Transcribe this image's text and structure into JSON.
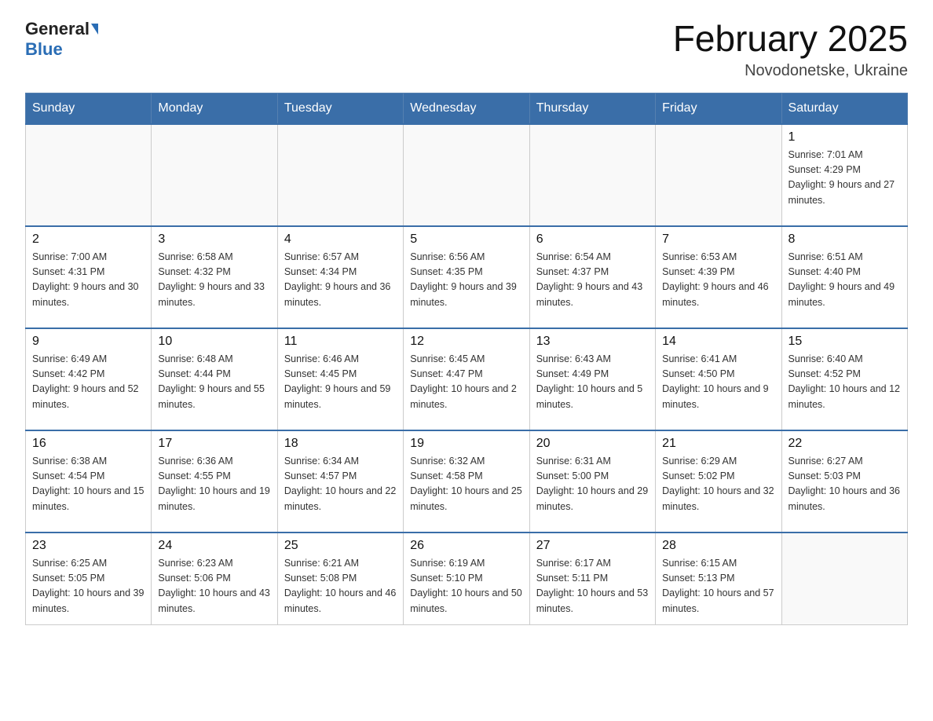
{
  "header": {
    "logo_general": "General",
    "logo_blue": "Blue",
    "title": "February 2025",
    "location": "Novodonetske, Ukraine"
  },
  "weekdays": [
    "Sunday",
    "Monday",
    "Tuesday",
    "Wednesday",
    "Thursday",
    "Friday",
    "Saturday"
  ],
  "weeks": [
    [
      {
        "day": "",
        "info": ""
      },
      {
        "day": "",
        "info": ""
      },
      {
        "day": "",
        "info": ""
      },
      {
        "day": "",
        "info": ""
      },
      {
        "day": "",
        "info": ""
      },
      {
        "day": "",
        "info": ""
      },
      {
        "day": "1",
        "info": "Sunrise: 7:01 AM\nSunset: 4:29 PM\nDaylight: 9 hours and 27 minutes."
      }
    ],
    [
      {
        "day": "2",
        "info": "Sunrise: 7:00 AM\nSunset: 4:31 PM\nDaylight: 9 hours and 30 minutes."
      },
      {
        "day": "3",
        "info": "Sunrise: 6:58 AM\nSunset: 4:32 PM\nDaylight: 9 hours and 33 minutes."
      },
      {
        "day": "4",
        "info": "Sunrise: 6:57 AM\nSunset: 4:34 PM\nDaylight: 9 hours and 36 minutes."
      },
      {
        "day": "5",
        "info": "Sunrise: 6:56 AM\nSunset: 4:35 PM\nDaylight: 9 hours and 39 minutes."
      },
      {
        "day": "6",
        "info": "Sunrise: 6:54 AM\nSunset: 4:37 PM\nDaylight: 9 hours and 43 minutes."
      },
      {
        "day": "7",
        "info": "Sunrise: 6:53 AM\nSunset: 4:39 PM\nDaylight: 9 hours and 46 minutes."
      },
      {
        "day": "8",
        "info": "Sunrise: 6:51 AM\nSunset: 4:40 PM\nDaylight: 9 hours and 49 minutes."
      }
    ],
    [
      {
        "day": "9",
        "info": "Sunrise: 6:49 AM\nSunset: 4:42 PM\nDaylight: 9 hours and 52 minutes."
      },
      {
        "day": "10",
        "info": "Sunrise: 6:48 AM\nSunset: 4:44 PM\nDaylight: 9 hours and 55 minutes."
      },
      {
        "day": "11",
        "info": "Sunrise: 6:46 AM\nSunset: 4:45 PM\nDaylight: 9 hours and 59 minutes."
      },
      {
        "day": "12",
        "info": "Sunrise: 6:45 AM\nSunset: 4:47 PM\nDaylight: 10 hours and 2 minutes."
      },
      {
        "day": "13",
        "info": "Sunrise: 6:43 AM\nSunset: 4:49 PM\nDaylight: 10 hours and 5 minutes."
      },
      {
        "day": "14",
        "info": "Sunrise: 6:41 AM\nSunset: 4:50 PM\nDaylight: 10 hours and 9 minutes."
      },
      {
        "day": "15",
        "info": "Sunrise: 6:40 AM\nSunset: 4:52 PM\nDaylight: 10 hours and 12 minutes."
      }
    ],
    [
      {
        "day": "16",
        "info": "Sunrise: 6:38 AM\nSunset: 4:54 PM\nDaylight: 10 hours and 15 minutes."
      },
      {
        "day": "17",
        "info": "Sunrise: 6:36 AM\nSunset: 4:55 PM\nDaylight: 10 hours and 19 minutes."
      },
      {
        "day": "18",
        "info": "Sunrise: 6:34 AM\nSunset: 4:57 PM\nDaylight: 10 hours and 22 minutes."
      },
      {
        "day": "19",
        "info": "Sunrise: 6:32 AM\nSunset: 4:58 PM\nDaylight: 10 hours and 25 minutes."
      },
      {
        "day": "20",
        "info": "Sunrise: 6:31 AM\nSunset: 5:00 PM\nDaylight: 10 hours and 29 minutes."
      },
      {
        "day": "21",
        "info": "Sunrise: 6:29 AM\nSunset: 5:02 PM\nDaylight: 10 hours and 32 minutes."
      },
      {
        "day": "22",
        "info": "Sunrise: 6:27 AM\nSunset: 5:03 PM\nDaylight: 10 hours and 36 minutes."
      }
    ],
    [
      {
        "day": "23",
        "info": "Sunrise: 6:25 AM\nSunset: 5:05 PM\nDaylight: 10 hours and 39 minutes."
      },
      {
        "day": "24",
        "info": "Sunrise: 6:23 AM\nSunset: 5:06 PM\nDaylight: 10 hours and 43 minutes."
      },
      {
        "day": "25",
        "info": "Sunrise: 6:21 AM\nSunset: 5:08 PM\nDaylight: 10 hours and 46 minutes."
      },
      {
        "day": "26",
        "info": "Sunrise: 6:19 AM\nSunset: 5:10 PM\nDaylight: 10 hours and 50 minutes."
      },
      {
        "day": "27",
        "info": "Sunrise: 6:17 AM\nSunset: 5:11 PM\nDaylight: 10 hours and 53 minutes."
      },
      {
        "day": "28",
        "info": "Sunrise: 6:15 AM\nSunset: 5:13 PM\nDaylight: 10 hours and 57 minutes."
      },
      {
        "day": "",
        "info": ""
      }
    ]
  ]
}
